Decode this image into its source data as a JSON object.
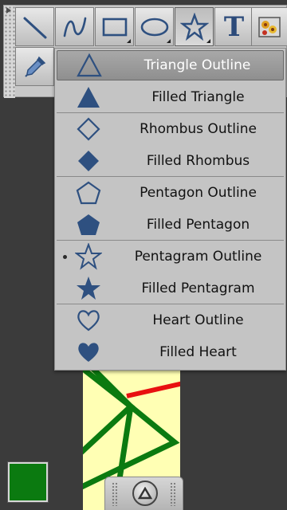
{
  "toolbar": {
    "tools": [
      {
        "name": "line-tool",
        "icon": "line-icon"
      },
      {
        "name": "freehand-tool",
        "icon": "freehand-curve-icon"
      },
      {
        "name": "rectangle-tool",
        "icon": "rectangle-icon"
      },
      {
        "name": "ellipse-tool",
        "icon": "ellipse-icon"
      },
      {
        "name": "shape-tool",
        "icon": "star-icon",
        "active": true
      },
      {
        "name": "text-tool",
        "icon": "text-icon",
        "label": "T"
      },
      {
        "name": "image-tool",
        "icon": "image-icon"
      },
      {
        "name": "eyedropper-tool",
        "icon": "eyedropper-icon"
      }
    ]
  },
  "shape_menu": {
    "items": [
      {
        "label": "Triangle Outline",
        "icon": "triangle-outline-icon",
        "highlighted": true
      },
      {
        "label": "Filled Triangle",
        "icon": "filled-triangle-icon"
      },
      {
        "label": "Rhombus Outline",
        "icon": "rhombus-outline-icon"
      },
      {
        "label": "Filled Rhombus",
        "icon": "filled-rhombus-icon"
      },
      {
        "label": "Pentagon Outline",
        "icon": "pentagon-outline-icon"
      },
      {
        "label": "Filled Pentagon",
        "icon": "filled-pentagon-icon"
      },
      {
        "label": "Pentagram Outline",
        "icon": "pentagram-outline-icon",
        "selected": true
      },
      {
        "label": "Filled Pentagram",
        "icon": "filled-pentagram-icon"
      },
      {
        "label": "Heart Outline",
        "icon": "heart-outline-icon"
      },
      {
        "label": "Filled Heart",
        "icon": "filled-heart-icon"
      }
    ]
  },
  "colors": {
    "icon_blue": "#2e5080",
    "current_color": "#0b7a10",
    "canvas_background": "#ffffb4"
  },
  "bottom_handle": {
    "icon": "collapse-up-icon"
  }
}
